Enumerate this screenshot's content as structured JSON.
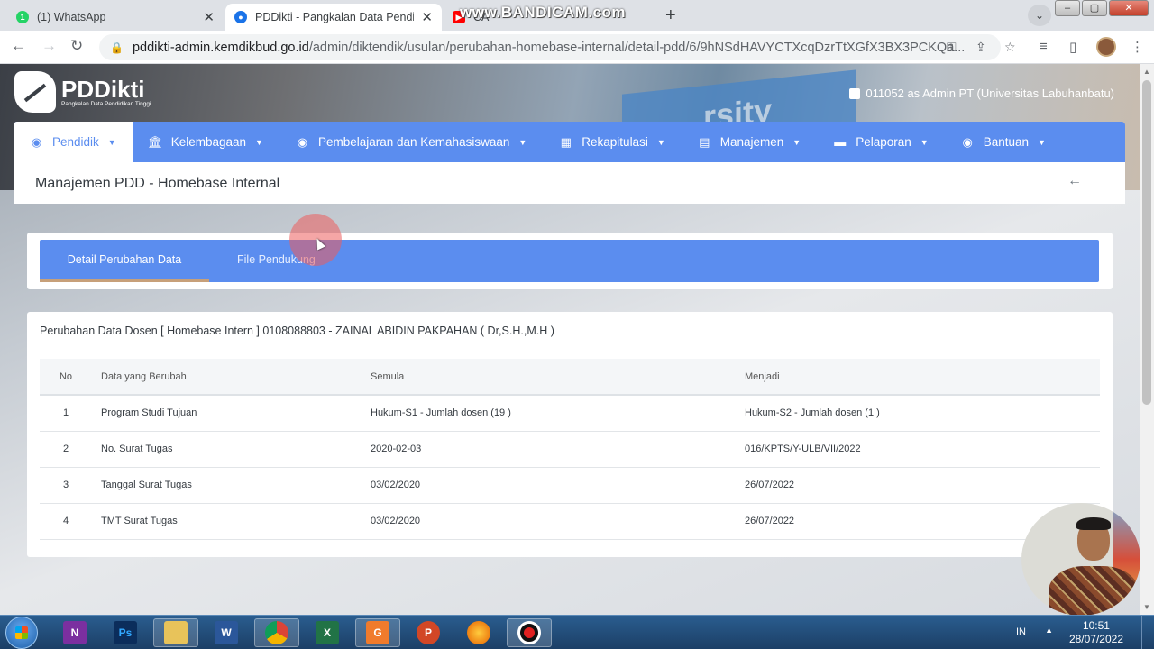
{
  "browser": {
    "tabs": [
      {
        "title": "(1) WhatsApp",
        "favicon": "whatsapp-icon",
        "color": "#25d366"
      },
      {
        "title": "PDDikti - Pangkalan Data Pendidikan Tinggi",
        "favicon": "pddikti-icon",
        "color": "#1a73e8"
      },
      {
        "title": "CA",
        "favicon": "youtube-icon",
        "color": "#ff0000"
      }
    ],
    "watermark": "www.BANDICAM.com",
    "url_host": "pddikti-admin.kemdikbud.go.id",
    "url_path": "/admin/diktendik/usulan/perubahan-homebase-internal/detail-pdd/6/9hNSdHAVYCTXcqDzrTtXGfX3BX3PCKQa..."
  },
  "app": {
    "logo_name": "PDDikti",
    "logo_sub": "Pangkalan Data Pendidikan Tinggi",
    "user": "011052 as Admin PT (Universitas Labuhanbatu)",
    "menu": [
      {
        "label": "Pendidik",
        "icon": "person-circle-icon"
      },
      {
        "label": "Kelembagaan",
        "icon": "institution-icon"
      },
      {
        "label": "Pembelajaran dan Kemahasiswaan",
        "icon": "person-circle-icon"
      },
      {
        "label": "Rekapitulasi",
        "icon": "bar-chart-icon"
      },
      {
        "label": "Manajemen",
        "icon": "document-icon"
      },
      {
        "label": "Pelaporan",
        "icon": "folder-icon"
      },
      {
        "label": "Bantuan",
        "icon": "person-circle-icon"
      }
    ],
    "page_title": "Manajemen PDD - Homebase Internal",
    "tabs": [
      "Detail Perubahan Data",
      "File Pendukung"
    ],
    "card_title": "Perubahan Data Dosen [ Homebase Intern ] 0108088803 - ZAINAL ABIDIN PAKPAHAN ( Dr,S.H.,M.H )",
    "table": {
      "headers": [
        "No",
        "Data yang Berubah",
        "Semula",
        "Menjadi"
      ],
      "rows": [
        [
          "1",
          "Program Studi Tujuan",
          "Hukum-S1 - Jumlah dosen (19 )",
          "Hukum-S2 - Jumlah dosen (1 )"
        ],
        [
          "2",
          "No. Surat Tugas",
          "2020-02-03",
          "016/KPTS/Y-ULB/VII/2022"
        ],
        [
          "3",
          "Tanggal Surat Tugas",
          "03/02/2020",
          "26/07/2022"
        ],
        [
          "4",
          "TMT Surat Tugas",
          "03/02/2020",
          "26/07/2022"
        ]
      ]
    },
    "accent_color": "#5b8def"
  },
  "taskbar": {
    "apps": [
      {
        "name": "onenote-icon",
        "label": "N",
        "color": "#7b2fa0"
      },
      {
        "name": "photoshop-icon",
        "label": "Ps",
        "color": "#0b2d5b"
      },
      {
        "name": "file-explorer-icon",
        "label": "",
        "color": "#e8c35a"
      },
      {
        "name": "word-icon",
        "label": "W",
        "color": "#2b579a"
      },
      {
        "name": "chrome-icon",
        "label": "",
        "color": "#db4437"
      },
      {
        "name": "excel-icon",
        "label": "X",
        "color": "#217346"
      },
      {
        "name": "wps-pdf-icon",
        "label": "G",
        "color": "#f07b2c"
      },
      {
        "name": "powerpoint-icon",
        "label": "P",
        "color": "#d24726"
      },
      {
        "name": "firefox-icon",
        "label": "",
        "color": "#e66000"
      },
      {
        "name": "bandicam-record-icon",
        "label": "",
        "color": "#111111"
      }
    ],
    "lang": "IN",
    "time": "10:51",
    "date": "28/07/2022"
  }
}
